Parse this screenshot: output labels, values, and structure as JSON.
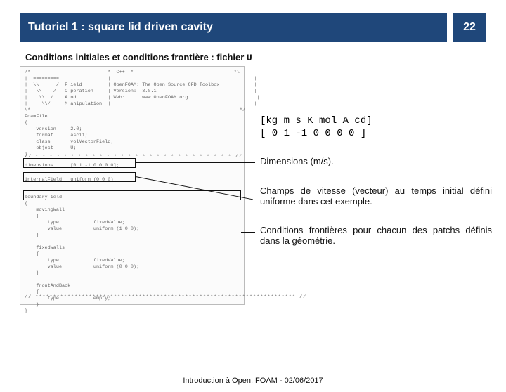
{
  "header": {
    "title": "Tutoriel 1 : square lid driven cavity",
    "page": "22"
  },
  "subtitle_prefix": "Conditions initiales et conditions frontière : fichier ",
  "subtitle_file": "U",
  "dim_line1": "[kg m s  K mol A cd]",
  "dim_line2": "[ 0 1 -1 0 0   0 0 ]",
  "callout1": "Dimensions (m/s).",
  "callout2": "Champs de vitesse (vecteur) au temps initial défini uniforme dans cet exemple.",
  "callout3": "Conditions frontières pour chacun des patchs définis dans la géométrie.",
  "footer": "Introduction à Open. FOAM - 02/06/2017",
  "code_top": "/*---------------------------*- C++ -*-----------------------------------*\\\n|  =========                 |                                                  |\n|  \\\\      /  F ield         | OpenFOAM: The Open Source CFD Toolbox            |\n|   \\\\    /   O peration     | Version:  3.0.1                                  |\n|    \\\\  /    A nd           | Web:      www.OpenFOAM.org                        |\n|     \\\\/     M anipulation  |                                                  |\n\\*-------------------------------------------------------------------------*/\nFoamFile\n{\n    version     2.0;\n    format      ascii;\n    class       volVectorField;\n    object      U;\n}",
  "code_dim": "dimensions      [0 1 -1 0 0 0 0];",
  "code_int": "internalField   uniform (0 0 0);",
  "code_bf": "boundaryField\n{\n    movingWall\n    {\n        type            fixedValue;\n        value           uniform (1 0 0);\n    }\n\n    fixedWalls\n    {\n        type            fixedValue;\n        value           uniform (0 0 0);\n    }\n\n    frontAndBack\n    {\n        type            empty;\n    }\n}",
  "code_stars1": "// * * * * * * * * * * * * * * * * * * * * * * * * * * * * //",
  "code_stars2": "// ************************************************************************* //"
}
